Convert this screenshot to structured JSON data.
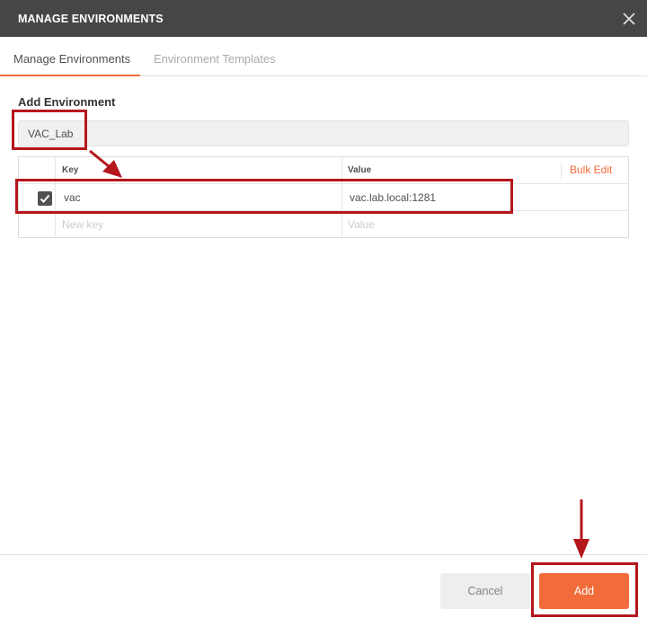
{
  "dialog": {
    "title": "MANAGE ENVIRONMENTS",
    "close_icon": "close-icon"
  },
  "tabs": [
    {
      "label": "Manage Environments",
      "active": true
    },
    {
      "label": "Environment Templates",
      "active": false
    }
  ],
  "form": {
    "section_label": "Add Environment",
    "environment_name": "VAC_Lab"
  },
  "table": {
    "headers": {
      "key": "Key",
      "value": "Value"
    },
    "bulk_edit_label": "Bulk Edit",
    "rows": [
      {
        "enabled": true,
        "key": "vac",
        "value": "vac.lab.local:1281"
      }
    ],
    "new_row": {
      "key_placeholder": "New key",
      "value_placeholder": "Value"
    }
  },
  "footer": {
    "cancel_label": "Cancel",
    "add_label": "Add"
  },
  "colors": {
    "titlebar": "#464646",
    "accent": "#f26b3a",
    "annotation": "#b5161d"
  }
}
